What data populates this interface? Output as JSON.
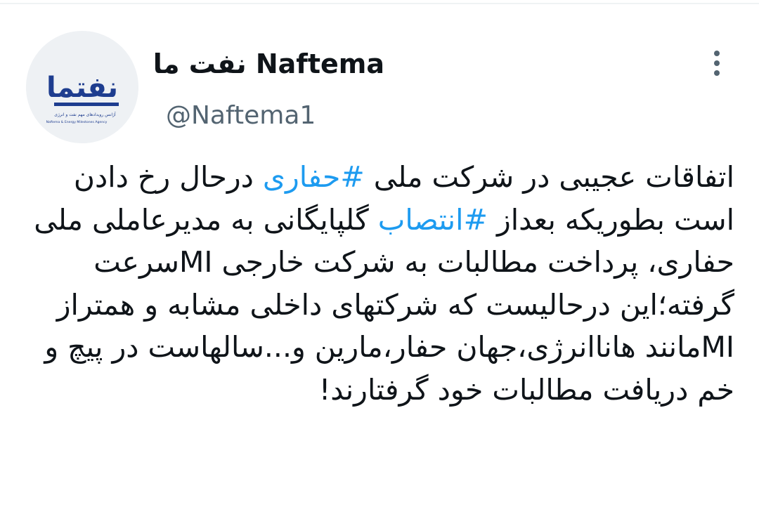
{
  "tweet": {
    "display_name": "Naftema نفت ما",
    "handle": "@Naftema1",
    "text_segments": [
      "اتفاقات عجیبی در شرکت ملی ",
      "#حفاری",
      " درحال رخ دادن است بطوریکه بعداز ",
      "#انتصاب",
      " گلپایگانی به مدیرعاملی ملی حفاری، پرداخت مطالبات به شرکت خارجی MIسرعت گرفته؛این درحالیست که شرکتهای داخلی مشابه و همتراز MIمانند هاناانرژی،جهان حفار،مارین و...سالهاست در پیچ و خم دریافت مطالبات خود گرفتارند!"
    ],
    "hashtags": [
      "#حفاری",
      "#انتصاب"
    ]
  },
  "avatar": {
    "logo_text": "نفتما",
    "tagline": "آژانس رویدادهای مهم نفت و انرژی",
    "tagline_en": "Naftema & Energy Milestones Agency"
  },
  "icons": {
    "more": "more-vertical-icon"
  },
  "colors": {
    "text": "#0f1419",
    "secondary": "#536471",
    "link": "#1d9bf0",
    "logo": "#1e3d8f"
  }
}
